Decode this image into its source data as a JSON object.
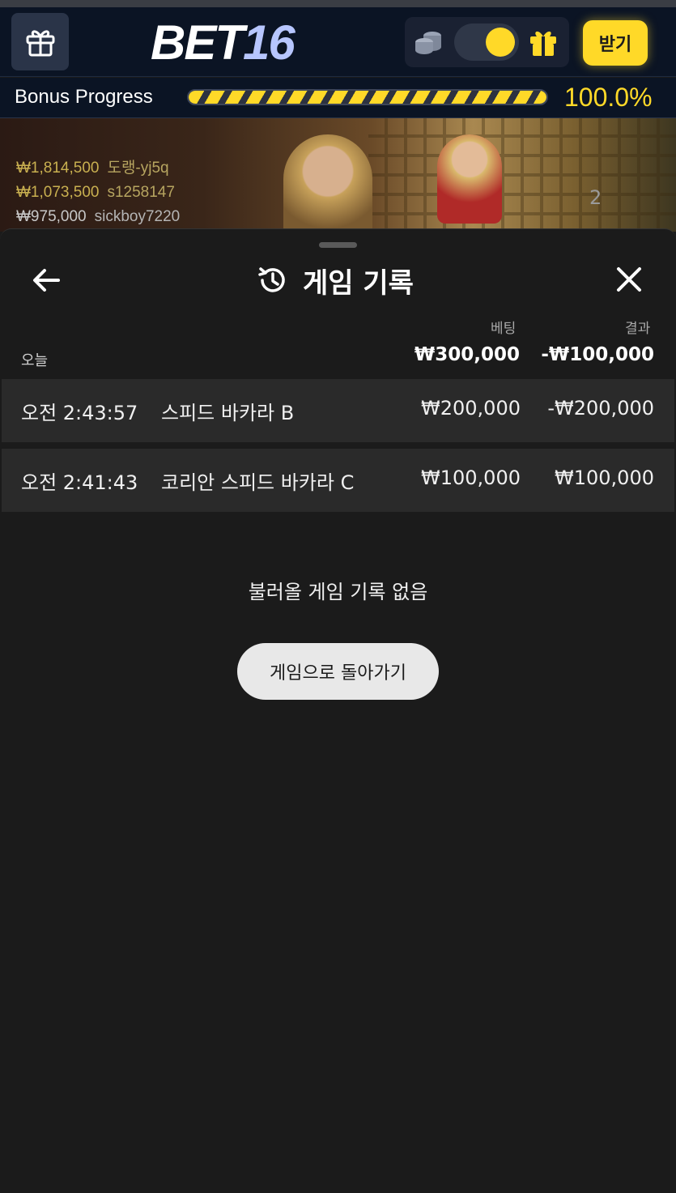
{
  "header": {
    "logo_main": "BET",
    "logo_num": "16",
    "claim_label": "받기",
    "icons": {
      "gift_button": "gift-box-icon",
      "coins": "coins-icon",
      "gift_small": "gift-icon"
    },
    "toggle_on": true,
    "accent_color": "#ffd928"
  },
  "progress": {
    "label": "Bonus Progress",
    "value_text": "100.0%",
    "fill_fraction": 1.0
  },
  "video": {
    "winners": [
      {
        "amount": "₩1,814,500",
        "name": "도랭-yj5q"
      },
      {
        "amount": "₩1,073,500",
        "name": "s1258147"
      },
      {
        "amount": "₩975,000",
        "name": "sickboy7220"
      }
    ],
    "count": "2"
  },
  "sheet": {
    "title": "게임 기록",
    "col_bet": "베팅",
    "col_result": "결과",
    "day": {
      "label": "오늘",
      "bet": "₩300,000",
      "result": "-₩100,000"
    },
    "rows": [
      {
        "time": "오전 2:43:57",
        "game": "스피드 바카라 B",
        "bet": "₩200,000",
        "result": "-₩200,000"
      },
      {
        "time": "오전 2:41:43",
        "game": "코리안 스피드 바카라 C",
        "bet": "₩100,000",
        "result": "₩100,000"
      }
    ],
    "empty_message": "불러올 게임 기록 없음",
    "back_to_game": "게임으로 돌아가기"
  }
}
